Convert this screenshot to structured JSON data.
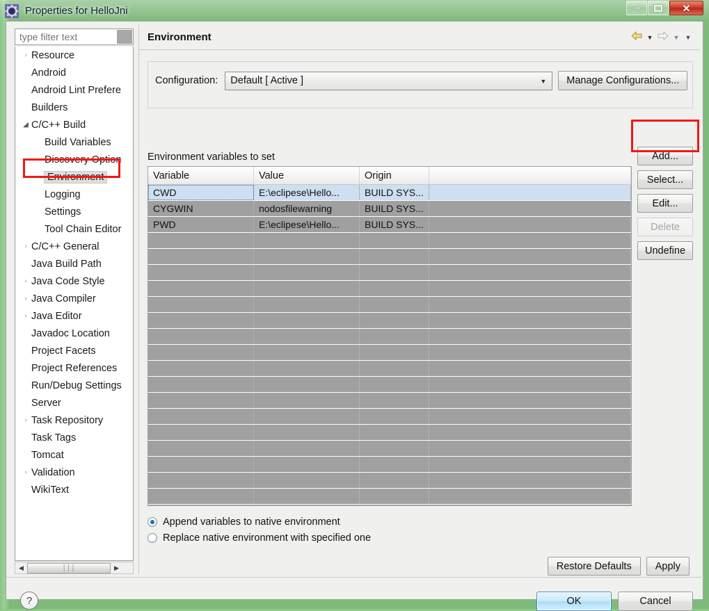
{
  "window": {
    "title": "Properties for HelloJni",
    "icon": "eclipse-gear-icon",
    "controls": {
      "minimize": "–",
      "maximize": "❐",
      "close": "✕"
    }
  },
  "sidebar": {
    "filter": {
      "placeholder": "type filter text",
      "value": ""
    },
    "items": [
      {
        "label": "Resource",
        "twisty": "collapsed",
        "indent": 0,
        "selected": false
      },
      {
        "label": "Android",
        "twisty": "none",
        "indent": 0,
        "selected": false
      },
      {
        "label": "Android Lint Prefere",
        "twisty": "none",
        "indent": 0,
        "selected": false
      },
      {
        "label": "Builders",
        "twisty": "none",
        "indent": 0,
        "selected": false
      },
      {
        "label": "C/C++ Build",
        "twisty": "expanded",
        "indent": 0,
        "selected": false
      },
      {
        "label": "Build Variables",
        "twisty": "none",
        "indent": 1,
        "selected": false
      },
      {
        "label": "Discovery Option",
        "twisty": "none",
        "indent": 1,
        "selected": false
      },
      {
        "label": "Environment",
        "twisty": "none",
        "indent": 1,
        "selected": true
      },
      {
        "label": "Logging",
        "twisty": "none",
        "indent": 1,
        "selected": false
      },
      {
        "label": "Settings",
        "twisty": "none",
        "indent": 1,
        "selected": false
      },
      {
        "label": "Tool Chain Editor",
        "twisty": "none",
        "indent": 1,
        "selected": false
      },
      {
        "label": "C/C++ General",
        "twisty": "collapsed",
        "indent": 0,
        "selected": false
      },
      {
        "label": "Java Build Path",
        "twisty": "none",
        "indent": 0,
        "selected": false
      },
      {
        "label": "Java Code Style",
        "twisty": "collapsed",
        "indent": 0,
        "selected": false
      },
      {
        "label": "Java Compiler",
        "twisty": "collapsed",
        "indent": 0,
        "selected": false
      },
      {
        "label": "Java Editor",
        "twisty": "collapsed",
        "indent": 0,
        "selected": false
      },
      {
        "label": "Javadoc Location",
        "twisty": "none",
        "indent": 0,
        "selected": false
      },
      {
        "label": "Project Facets",
        "twisty": "none",
        "indent": 0,
        "selected": false
      },
      {
        "label": "Project References",
        "twisty": "none",
        "indent": 0,
        "selected": false
      },
      {
        "label": "Run/Debug Settings",
        "twisty": "none",
        "indent": 0,
        "selected": false
      },
      {
        "label": "Server",
        "twisty": "none",
        "indent": 0,
        "selected": false
      },
      {
        "label": "Task Repository",
        "twisty": "collapsed",
        "indent": 0,
        "selected": false
      },
      {
        "label": "Task Tags",
        "twisty": "none",
        "indent": 0,
        "selected": false
      },
      {
        "label": "Tomcat",
        "twisty": "none",
        "indent": 0,
        "selected": false
      },
      {
        "label": "Validation",
        "twisty": "collapsed",
        "indent": 0,
        "selected": false
      },
      {
        "label": "WikiText",
        "twisty": "none",
        "indent": 0,
        "selected": false
      }
    ],
    "scrollbar": {
      "left_arrow": "◀",
      "right_arrow": "▶",
      "grip": "‖‖"
    }
  },
  "page": {
    "title": "Environment",
    "nav": {
      "back_icon": "back-arrow-icon",
      "back_caret": "▼",
      "forward_icon": "forward-arrow-icon",
      "forward_caret": "▼",
      "menu_caret": "▼"
    },
    "configuration": {
      "label": "Configuration:",
      "value": "Default  [ Active ]",
      "arrow": "▼",
      "manage_button": "Manage Configurations..."
    },
    "table": {
      "caption": "Environment variables to set",
      "columns": [
        "Variable",
        "Value",
        "Origin",
        ""
      ],
      "rows": [
        {
          "variable": "CWD",
          "value": "E:\\eclipese\\Hello...",
          "origin": "BUILD SYS...",
          "extra": "",
          "selected": true
        },
        {
          "variable": "CYGWIN",
          "value": "nodosfilewarning",
          "origin": "BUILD SYS...",
          "extra": "",
          "selected": false
        },
        {
          "variable": "PWD",
          "value": "E:\\eclipese\\Hello...",
          "origin": "BUILD SYS...",
          "extra": "",
          "selected": false
        }
      ],
      "empty_row_count": 17
    },
    "side_buttons": [
      {
        "label": "Add...",
        "enabled": true,
        "highlighted": true
      },
      {
        "label": "Select...",
        "enabled": true,
        "highlighted": false
      },
      {
        "label": "Edit...",
        "enabled": true,
        "highlighted": false
      },
      {
        "label": "Delete",
        "enabled": false,
        "highlighted": false
      },
      {
        "label": "Undefine",
        "enabled": true,
        "highlighted": false
      }
    ],
    "radios": [
      {
        "label": "Append variables to native environment",
        "selected": true
      },
      {
        "label": "Replace native environment with specified one",
        "selected": false
      }
    ],
    "page_buttons": [
      {
        "label": "Restore Defaults"
      },
      {
        "label": "Apply"
      }
    ]
  },
  "footer": {
    "help_icon": "?",
    "buttons": [
      {
        "label": "OK",
        "default": true
      },
      {
        "label": "Cancel",
        "default": false
      }
    ]
  },
  "colors": {
    "frame": "#7db87a",
    "annotation": "#ee1b12",
    "selection": "#cddff0",
    "table_body": "#a0a0a0",
    "default_button": "#aadcf6"
  }
}
